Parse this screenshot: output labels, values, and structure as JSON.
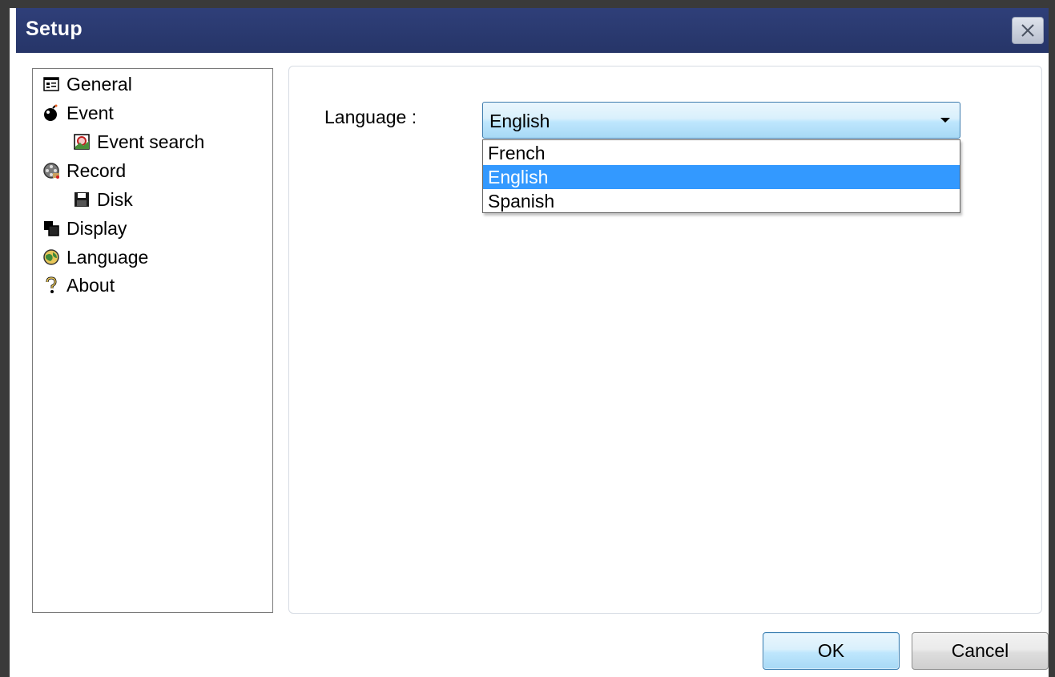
{
  "window": {
    "title": "Setup",
    "close_icon": "close-icon",
    "title_bar_color": "#2f3f79"
  },
  "tree": {
    "items": [
      {
        "label": "General",
        "icon": "general-icon"
      },
      {
        "label": "Event",
        "icon": "bomb-icon"
      },
      {
        "label": "Event search",
        "icon": "event-search-icon"
      },
      {
        "label": "Record",
        "icon": "film-reel-icon"
      },
      {
        "label": "Disk",
        "icon": "floppy-disk-icon"
      },
      {
        "label": "Display",
        "icon": "display-windows-icon"
      },
      {
        "label": "Language",
        "icon": "globe-icon"
      },
      {
        "label": "About",
        "icon": "question-mark-icon"
      }
    ]
  },
  "language_panel": {
    "label": "Language :",
    "selected_value": "English",
    "options": [
      "French",
      "English",
      "Spanish"
    ],
    "highlighted_option": "English",
    "highlight_color": "#3399ff"
  },
  "buttons": {
    "ok_label": "OK",
    "cancel_label": "Cancel"
  }
}
